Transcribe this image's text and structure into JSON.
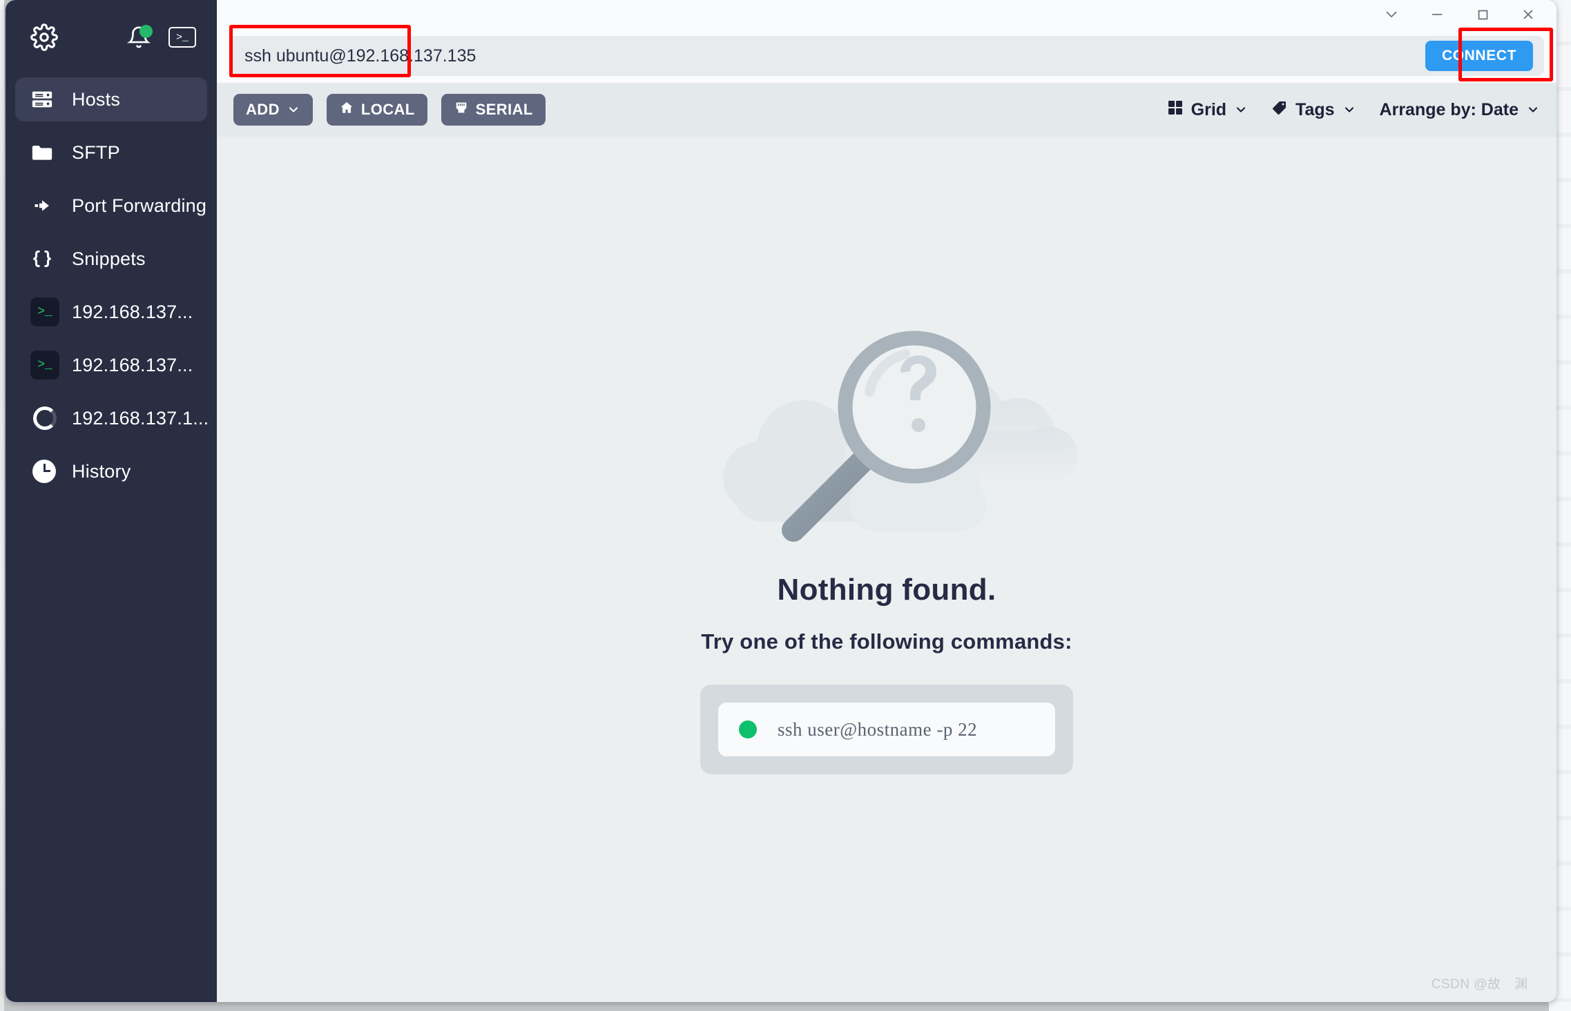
{
  "window": {
    "controls": [
      {
        "name": "collapse",
        "glyph": "chevron-down"
      },
      {
        "name": "minimize",
        "glyph": "minus"
      },
      {
        "name": "maximize",
        "glyph": "square"
      },
      {
        "name": "close",
        "glyph": "x"
      }
    ]
  },
  "sidebar": {
    "top_icons": [
      {
        "name": "settings",
        "label": "gear-icon"
      },
      {
        "name": "notifications",
        "label": "bell-icon",
        "badge": true
      },
      {
        "name": "quick-terminal",
        "label": "terminal-icon",
        "glyph": ">_"
      }
    ],
    "items": [
      {
        "label": "Hosts",
        "icon": "server-icon",
        "active": true
      },
      {
        "label": "SFTP",
        "icon": "folder-icon",
        "active": false
      },
      {
        "label": "Port Forwarding",
        "icon": "arrow-forward-icon",
        "active": false
      },
      {
        "label": "Snippets",
        "icon": "braces-icon",
        "active": false
      }
    ],
    "hosts": [
      {
        "label": "192.168.137...",
        "icon": "terminal-icon",
        "glyph": ">_"
      },
      {
        "label": "192.168.137...",
        "icon": "terminal-icon",
        "glyph": ">_"
      },
      {
        "label": "192.168.137.1...",
        "icon": "spinner-icon"
      }
    ],
    "history": {
      "label": "History",
      "icon": "clock-icon"
    }
  },
  "search": {
    "value": "ssh ubuntu@192.168.137.135",
    "placeholder": "",
    "connect_label": "CONNECT"
  },
  "toolbar": {
    "add_label": "ADD",
    "local_label": "LOCAL",
    "serial_label": "SERIAL",
    "grid_label": "Grid",
    "tags_label": "Tags",
    "arrange_label": "Arrange by: Date"
  },
  "empty_state": {
    "title": "Nothing found.",
    "subtitle": "Try one of the following commands:",
    "commands": [
      {
        "text": "ssh user@hostname -p 22",
        "status_color": "#0ec06c"
      }
    ]
  },
  "watermark": "CSDN @故　渊　",
  "colors": {
    "sidebar_bg": "#2a2e43",
    "accent_blue": "#2e9af2",
    "annotation_red": "#fe0000",
    "status_green": "#0ec06c",
    "content_bg": "#eceff0",
    "pill_bg": "#5f667e"
  }
}
